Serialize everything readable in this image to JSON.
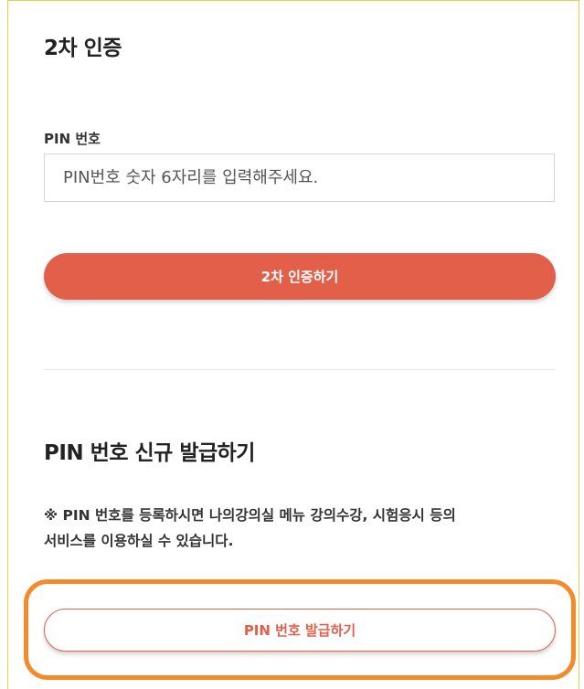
{
  "auth": {
    "title": "2차 인증",
    "pin_label": "PIN 번호",
    "pin_placeholder": "PIN번호 숫자 6자리를 입력해주세요.",
    "pin_value": "",
    "submit_label": "2차 인증하기"
  },
  "issue": {
    "title": "PIN 번호 신규 발급하기",
    "notice_line1": "※ PIN 번호를 등록하시면 나의강의실 메뉴 강의수강, 시험응시 등의",
    "notice_line2": "서비스를 이용하실 수 있습니다.",
    "issue_button_label": "PIN 번호 발급하기"
  },
  "colors": {
    "accent": "#e2604a",
    "highlight_ring": "#f58a2a",
    "panel_border": "#f2c94c"
  }
}
